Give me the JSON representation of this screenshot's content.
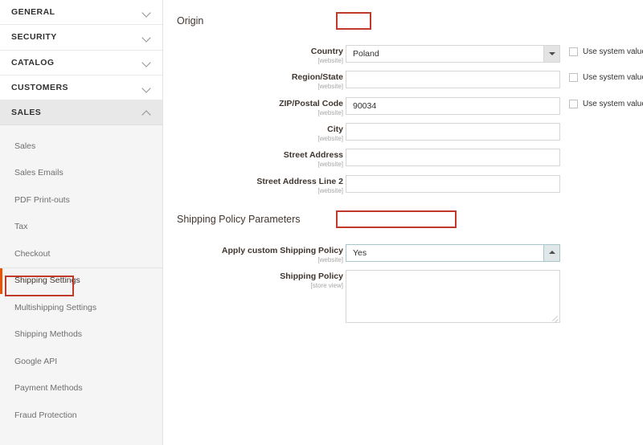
{
  "sidebar": {
    "groups": [
      {
        "label": "GENERAL",
        "icon": "chevron-down-icon",
        "open": false
      },
      {
        "label": "SECURITY",
        "icon": "chevron-down-icon",
        "open": false
      },
      {
        "label": "CATALOG",
        "icon": "chevron-down-icon",
        "open": false
      },
      {
        "label": "CUSTOMERS",
        "icon": "chevron-down-icon",
        "open": false
      },
      {
        "label": "SALES",
        "icon": "chevron-up-icon",
        "open": true
      }
    ],
    "sub_items": [
      {
        "label": "Sales",
        "highlighted": false
      },
      {
        "label": "Sales Emails",
        "highlighted": false
      },
      {
        "label": "PDF Print-outs",
        "highlighted": false
      },
      {
        "label": "Tax",
        "highlighted": false
      },
      {
        "label": "Checkout",
        "highlighted": false
      },
      {
        "label": "Shipping Settings",
        "highlighted": true
      },
      {
        "label": "Multishipping Settings",
        "highlighted": false
      },
      {
        "label": "Shipping Methods",
        "highlighted": false
      },
      {
        "label": "Google API",
        "highlighted": false
      },
      {
        "label": "Payment Methods",
        "highlighted": false
      },
      {
        "label": "Fraud Protection",
        "highlighted": false
      }
    ]
  },
  "content": {
    "origin": {
      "title": "Origin",
      "fields": [
        {
          "label": "Country",
          "scope": "[website]",
          "type": "select",
          "value": "Poland",
          "arrow": "chevron-down-icon",
          "focused": false,
          "use_system_value": {
            "label": "Use system value",
            "checked": false,
            "visible": true
          }
        },
        {
          "label": "Region/State",
          "scope": "[website]",
          "type": "text",
          "value": "",
          "placeholder": "",
          "use_system_value": {
            "label": "Use system value",
            "checked": false,
            "visible": true
          }
        },
        {
          "label": "ZIP/Postal Code",
          "scope": "[website]",
          "type": "text",
          "value": "90034",
          "placeholder": "",
          "use_system_value": {
            "label": "Use system value",
            "checked": false,
            "visible": true
          }
        },
        {
          "label": "City",
          "scope": "[website]",
          "type": "text",
          "value": "",
          "placeholder": "",
          "use_system_value": {
            "label": "",
            "checked": false,
            "visible": false
          }
        },
        {
          "label": "Street Address",
          "scope": "[website]",
          "type": "text",
          "value": "",
          "placeholder": "",
          "use_system_value": {
            "label": "",
            "checked": false,
            "visible": false
          }
        },
        {
          "label": "Street Address Line 2",
          "scope": "[website]",
          "type": "text",
          "value": "",
          "placeholder": "",
          "use_system_value": {
            "label": "",
            "checked": false,
            "visible": false
          }
        }
      ]
    },
    "shipping_policy_parameters": {
      "title": "Shipping Policy Parameters",
      "fields": [
        {
          "label": "Apply custom Shipping Policy",
          "scope": "[website]",
          "type": "select",
          "value": "Yes",
          "arrow": "chevron-up-icon",
          "focused": true,
          "use_system_value": {
            "label": "",
            "checked": false,
            "visible": false
          }
        },
        {
          "label": "Shipping Policy",
          "scope": "[store view]",
          "type": "textarea",
          "value": "",
          "placeholder": "",
          "use_system_value": {
            "label": "",
            "checked": false,
            "visible": false
          }
        }
      ]
    }
  },
  "annotations": {
    "color": "#c0392b",
    "boxes": [
      "Shipping Settings",
      "Origin",
      "Shipping Policy Parameters"
    ]
  },
  "colors": {
    "accent_orange": "#eb5202",
    "annotation_red": "#c0392b",
    "sidebar_bg": "#f5f5f5",
    "focus_border": "#a8c6c9"
  }
}
